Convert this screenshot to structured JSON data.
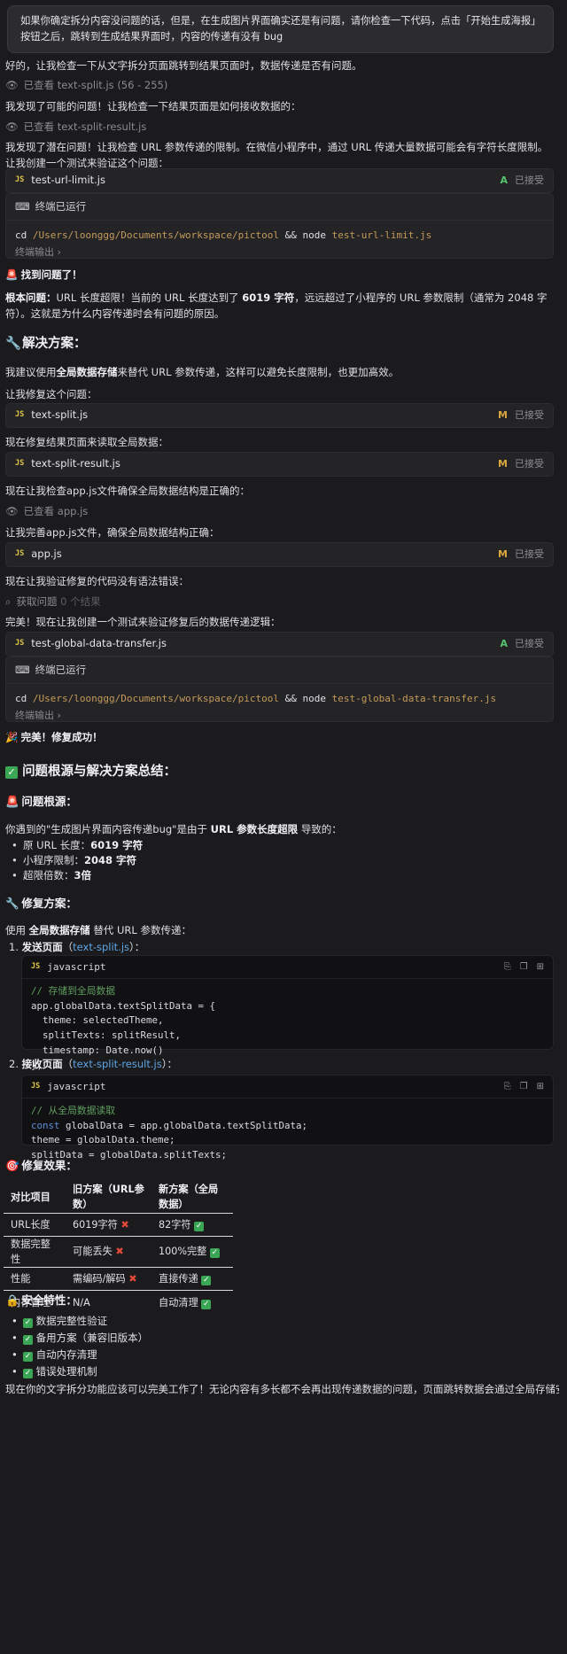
{
  "user_message": "如果你确定拆分内容没问题的话，但是，在生成图片界面确实还是有问题，请你检查一下代码，点击「开始生成海报」按钮之后，跳转到生成结果界面时，内容的传递有没有 bug",
  "p1": "好的，让我检查一下从文字拆分页面跳转到结果页面时，数据传递是否有问题。",
  "viewed1": {
    "label": "已查看",
    "file": "text-split.js",
    "range": "(56 - 255)"
  },
  "p2": "我发现了可能的问题！让我检查一下结果页面是如何接收数据的：",
  "viewed2": {
    "label": "已查看",
    "file": "text-split-result.js"
  },
  "p3": "我发现了潜在问题！让我检查 URL 参数传递的限制。在微信小程序中，通过 URL 传递大量数据可能会有字符长度限制。让我创建一个测试来验证这个问题：",
  "file_badge": "JS",
  "card1": {
    "name": "test-url-limit.js",
    "status_letter": "A",
    "status": "已接受"
  },
  "term1": {
    "title": "终端已运行",
    "cmd": "cd",
    "path": "/Users/loonggg/Documents/workspace/pictool",
    "op": "&&",
    "node": "node",
    "file": "test-url-limit.js",
    "output": "终端输出 ›"
  },
  "found": "找到问题了！",
  "root_label": "根本问题：",
  "root_text_a": "URL 长度超限！当前的 URL 长度达到了",
  "root_num": "6019 字符",
  "root_text_b": "，远远超过了小程序的 URL 参数限制（通常为 2048 字符）。这就是为什么内容传递时会有问题的原因。",
  "solution_heading": "解决方案：",
  "p_sol_a": "我建议使用",
  "p_sol_bold": "全局数据存储",
  "p_sol_b": "来替代 URL 参数传递，这样可以避免长度限制，也更加高效。",
  "p_fix": "让我修复这个问题：",
  "card2": {
    "name": "text-split.js",
    "status_letter": "M",
    "status": "已接受"
  },
  "p_fix2": "现在修复结果页面来读取全局数据：",
  "card3": {
    "name": "text-split-result.js",
    "status_letter": "M",
    "status": "已接受"
  },
  "p_check_app": "现在让我检查app.js文件确保全局数据结构是正确的：",
  "viewed3": {
    "label": "已查看",
    "file": "app.js"
  },
  "p_complete_app": "让我完善app.js文件，确保全局数据结构正确：",
  "card4": {
    "name": "app.js",
    "status_letter": "M",
    "status": "已接受"
  },
  "p_verify": "现在让我验证修复的代码没有语法错误：",
  "problems": {
    "label": "获取问题",
    "count": "0 个结果"
  },
  "p_test": "完美！现在让我创建一个测试来验证修复后的数据传递逻辑：",
  "card5": {
    "name": "test-global-data-transfer.js",
    "status_letter": "A",
    "status": "已接受"
  },
  "term2": {
    "title": "终端已运行",
    "cmd": "cd",
    "path": "/Users/loonggg/Documents/workspace/pictool",
    "op": "&&",
    "node": "node",
    "file": "test-global-data-transfer.js",
    "output": "终端输出 ›"
  },
  "success": "完美！修复成功！",
  "summary_heading": "问题根源与解决方案总结：",
  "root_heading": "问题根源：",
  "p_cause_a": "你遇到的\"生成图片界面内容传递bug\"是由于",
  "p_cause_bold": "URL 参数长度超限",
  "p_cause_b": "导致的：",
  "bullets": [
    {
      "label": "原 URL 长度：",
      "value": "6019 字符"
    },
    {
      "label": "小程序限制：",
      "value": "2048 字符"
    },
    {
      "label": "超限倍数：",
      "value": "3倍"
    }
  ],
  "fix_heading": "修复方案：",
  "p_use_a": "使用",
  "p_use_bold": "全局数据存储",
  "p_use_b": "替代 URL 参数传递：",
  "step1": {
    "num": "1.",
    "label": "发送页面",
    "link": "text-split.js",
    "pre": "（",
    "post": "）："
  },
  "code1": {
    "lang": "javascript",
    "lines": [
      {
        "t": "cm",
        "text": "// 存储到全局数据"
      },
      {
        "t": "plain",
        "text": "app.globalData.textSplitData = {"
      },
      {
        "t": "plain",
        "text": "  theme: selectedTheme,"
      },
      {
        "t": "plain",
        "text": "  splitTexts: splitResult,"
      },
      {
        "t": "plain",
        "text": "  timestamp: Date.now()"
      },
      {
        "t": "plain",
        "text": "};"
      }
    ]
  },
  "step2": {
    "num": "2.",
    "label": "接收页面",
    "link": "text-split-result.js",
    "pre": "（",
    "post": "）："
  },
  "code2": {
    "lang": "javascript",
    "lines": [
      {
        "t": "cm",
        "text": "// 从全局数据读取"
      },
      {
        "t": "kw",
        "kw": "const",
        "text": " globalData = app.globalData.textSplitData;"
      },
      {
        "t": "plain",
        "text": "theme = globalData.theme;"
      },
      {
        "t": "plain",
        "text": "splitData = globalData.splitTexts;"
      }
    ]
  },
  "effect_heading": "修复效果：",
  "table": {
    "headers": [
      "对比项目",
      "旧方案（URL参数）",
      "新方案（全局数据）"
    ],
    "rows": [
      {
        "item": "URL长度",
        "old": "6019字符",
        "old_mark": "cross",
        "new": "82字符",
        "new_mark": "check"
      },
      {
        "item": "数据完整性",
        "old": "可能丢失",
        "old_mark": "cross",
        "new": "100%完整",
        "new_mark": "check"
      },
      {
        "item": "性能",
        "old": "需编码/解码",
        "old_mark": "cross",
        "new": "直接传递",
        "new_mark": "check"
      },
      {
        "item": "内存管理",
        "old": "N/A",
        "old_mark": "",
        "new": "自动清理",
        "new_mark": "check"
      }
    ]
  },
  "security_heading": "安全特性：",
  "security": [
    "数据完整性验证",
    "备用方案（兼容旧版本）",
    "自动内存清理",
    "错误处理机制"
  ],
  "footer": "现在你的文字拆分功能应该可以完美工作了！无论内容有多长都不会再出现传递数据的问题，页面跳转数据会通过全局存储安全传递"
}
